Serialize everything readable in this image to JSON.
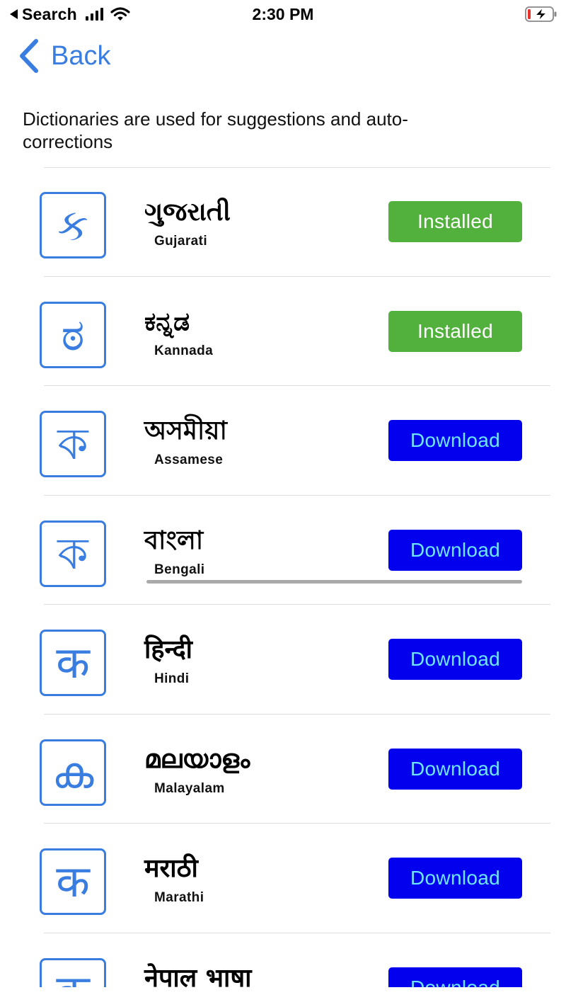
{
  "status_bar": {
    "back_app_label": "Search",
    "time": "2:30 PM",
    "icons": [
      "back-triangle-icon",
      "signal-icon",
      "wifi-icon",
      "battery-charging-icon"
    ]
  },
  "nav": {
    "back_label": "Back"
  },
  "description": "Dictionaries are used for suggestions and auto-corrections",
  "colors": {
    "accent": "#3a7de0",
    "installed_bg": "#52b03c",
    "download_bg": "#0300ee",
    "download_text": "#6fe6ff"
  },
  "dictionaries": [
    {
      "native": "ગુજરાતી",
      "english": "Gujarati",
      "icon_glyph": "ક",
      "status": "Installed"
    },
    {
      "native": "ಕನ್ನಡ",
      "english": "Kannada",
      "icon_glyph": "ಠ",
      "status": "Installed"
    },
    {
      "native": "অসমীয়া",
      "english": "Assamese",
      "icon_glyph": "ক",
      "status": "Download"
    },
    {
      "native": "বাংলা",
      "english": "Bengali",
      "icon_glyph": "ক",
      "status": "Download",
      "progress": 1.0
    },
    {
      "native": "हिन्दी",
      "english": "Hindi",
      "icon_glyph": "क",
      "status": "Download"
    },
    {
      "native": "മലയാളം",
      "english": "Malayalam",
      "icon_glyph": "ക",
      "status": "Download"
    },
    {
      "native": "मराठी",
      "english": "Marathi",
      "icon_glyph": "क",
      "status": "Download"
    },
    {
      "native": "नेपाल भाषा",
      "english": "",
      "icon_glyph": "क",
      "status": "Download"
    }
  ]
}
